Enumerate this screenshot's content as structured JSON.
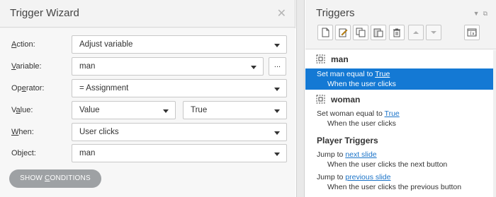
{
  "wizard": {
    "title": "Trigger Wizard",
    "close_glyph": "✕",
    "fields": {
      "action": {
        "label_hot": "A",
        "label_rest": "ction:",
        "value": "Adjust variable"
      },
      "variable": {
        "label_hot": "V",
        "label_rest": "ariable:",
        "value": "man",
        "extra_button": "..."
      },
      "operator": {
        "label_pre": "Op",
        "label_hot": "e",
        "label_rest": "rator:",
        "value": "= Assignment"
      },
      "value": {
        "label_pre": "V",
        "label_hot": "a",
        "label_rest": "lue:",
        "type_value": "Value",
        "value": "True"
      },
      "when": {
        "label_hot": "W",
        "label_rest": "hen:",
        "value": "User clicks"
      },
      "object": {
        "label": "Object:",
        "value": "man"
      }
    },
    "show_conditions": {
      "pre": "SHOW ",
      "hot": "C",
      "rest": "ONDITIONS"
    }
  },
  "triggers": {
    "title": "Triggers",
    "header_icons": [
      "pin-icon",
      "float-icon"
    ],
    "toolbar": [
      "new-trigger-icon",
      "edit-trigger-icon",
      "copy-icon",
      "paste-icon",
      "delete-icon",
      "move-up-icon",
      "move-down-icon",
      "variables-icon"
    ],
    "objects": [
      {
        "name": "man",
        "trigger": {
          "text": "Set man equal to ",
          "link": "True",
          "sub": "When the user clicks",
          "selected": true
        }
      },
      {
        "name": "woman",
        "trigger": {
          "text": "Set woman equal to ",
          "link": "True",
          "sub": "When the user clicks",
          "selected": false
        }
      }
    ],
    "player_section": {
      "title": "Player Triggers",
      "items": [
        {
          "text": "Jump to ",
          "link": "next slide",
          "sub": "When the user clicks the next button"
        },
        {
          "text": "Jump to ",
          "link": "previous slide",
          "sub": "When the user clicks the previous button"
        }
      ]
    }
  },
  "colors": {
    "selected_bg": "#1479d4",
    "link": "#1a73c8",
    "button_gray": "#9ea1a4"
  }
}
